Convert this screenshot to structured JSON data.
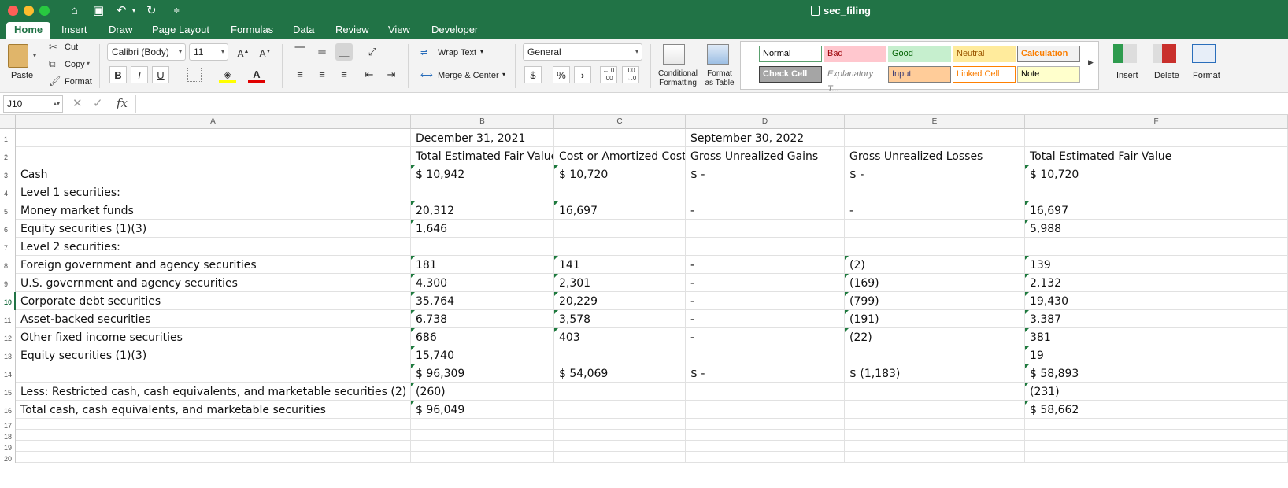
{
  "window": {
    "title": "sec_filing"
  },
  "tabs": [
    "Home",
    "Insert",
    "Draw",
    "Page Layout",
    "Formulas",
    "Data",
    "Review",
    "View",
    "Developer"
  ],
  "active_tab": "Home",
  "ribbon": {
    "paste_label": "Paste",
    "cut_label": "Cut",
    "copy_label": "Copy",
    "format_label": "Format",
    "font_name": "Calibri (Body)",
    "font_size": "11",
    "wrap_text_label": "Wrap Text",
    "merge_center_label": "Merge & Center",
    "number_format": "General",
    "conditional_formatting_label": "Conditional Formatting",
    "format_as_table_label": "Format as Table",
    "styles": [
      {
        "label": "Normal",
        "bg": "#ffffff",
        "fg": "#000000",
        "border": "#5aa06e"
      },
      {
        "label": "Bad",
        "bg": "#ffc7ce",
        "fg": "#9c0006",
        "border": "#ffc7ce"
      },
      {
        "label": "Good",
        "bg": "#c6efce",
        "fg": "#006100",
        "border": "#c6efce"
      },
      {
        "label": "Neutral",
        "bg": "#ffeb9c",
        "fg": "#9c5700",
        "border": "#ffeb9c"
      },
      {
        "label": "Calculation",
        "bg": "#f2f2f2",
        "fg": "#fa7d00",
        "border": "#7f7f7f"
      },
      {
        "label": "Check Cell",
        "bg": "#a5a5a5",
        "fg": "#ffffff",
        "border": "#3f3f3f"
      },
      {
        "label": "Explanatory T...",
        "bg": "#ffffff",
        "fg": "#7f7f7f",
        "border": "#ffffff"
      },
      {
        "label": "Input",
        "bg": "#ffcc99",
        "fg": "#3f3f76",
        "border": "#7f7f7f"
      },
      {
        "label": "Linked Cell",
        "bg": "#ffffff",
        "fg": "#fa7d00",
        "border": "#ff8001"
      },
      {
        "label": "Note",
        "bg": "#ffffcc",
        "fg": "#000000",
        "border": "#b2b2b2"
      }
    ],
    "insert_label": "Insert",
    "delete_label": "Delete",
    "format_cells_label": "Format"
  },
  "formula_bar": {
    "name_box": "J10",
    "fx": "fx",
    "content": ""
  },
  "sheet": {
    "columns": [
      "A",
      "B",
      "C",
      "D",
      "E",
      "F"
    ],
    "rows": [
      {
        "n": "1",
        "cells": [
          "",
          "December 31, 2021",
          "",
          "September 30, 2022",
          "",
          ""
        ]
      },
      {
        "n": "2",
        "cells": [
          "",
          "Total Estimated Fair Value",
          "Cost or Amortized Cost",
          "Gross Unrealized Gains",
          "Gross Unrealized Losses",
          "Total Estimated Fair Value"
        ]
      },
      {
        "n": "3",
        "cells": [
          "Cash",
          "$ 10,942",
          "$ 10,720",
          "$ -",
          "$ -",
          "$ 10,720"
        ]
      },
      {
        "n": "4",
        "cells": [
          "Level 1 securities:",
          "",
          "",
          "",
          "",
          ""
        ]
      },
      {
        "n": "5",
        "cells": [
          "Money market funds",
          "20,312",
          "16,697",
          "-",
          "-",
          "16,697"
        ]
      },
      {
        "n": "6",
        "cells": [
          "Equity securities (1)(3)",
          "1,646",
          "",
          "",
          "",
          "5,988"
        ]
      },
      {
        "n": "7",
        "cells": [
          "Level 2 securities:",
          "",
          "",
          "",
          "",
          ""
        ]
      },
      {
        "n": "8",
        "cells": [
          "Foreign government and agency securities",
          "181",
          "141",
          "-",
          "(2)",
          "139"
        ]
      },
      {
        "n": "9",
        "cells": [
          "U.S. government and agency securities",
          "4,300",
          "2,301",
          "-",
          "(169)",
          "2,132"
        ]
      },
      {
        "n": "10",
        "cells": [
          "Corporate debt securities",
          "35,764",
          "20,229",
          "-",
          "(799)",
          "19,430"
        ]
      },
      {
        "n": "11",
        "cells": [
          "Asset-backed securities",
          "6,738",
          "3,578",
          "-",
          "(191)",
          "3,387"
        ]
      },
      {
        "n": "12",
        "cells": [
          "Other fixed income securities",
          "686",
          "403",
          "-",
          "(22)",
          "381"
        ]
      },
      {
        "n": "13",
        "cells": [
          "Equity securities (1)(3)",
          "15,740",
          "",
          "",
          "",
          "19"
        ]
      },
      {
        "n": "14",
        "cells": [
          "",
          "$ 96,309",
          "$ 54,069",
          "$ -",
          "$ (1,183)",
          "$ 58,893"
        ]
      },
      {
        "n": "15",
        "cells": [
          "Less: Restricted cash, cash equivalents, and marketable securities (2)",
          "(260)",
          "",
          "",
          "",
          "(231)"
        ]
      },
      {
        "n": "16",
        "cells": [
          "Total cash, cash equivalents, and marketable securities",
          "$ 96,049",
          "",
          "",
          "",
          "$ 58,662"
        ]
      },
      {
        "n": "17",
        "cells": [
          "",
          "",
          "",
          "",
          "",
          ""
        ]
      },
      {
        "n": "18",
        "cells": [
          "",
          "",
          "",
          "",
          "",
          ""
        ]
      },
      {
        "n": "19",
        "cells": [
          "",
          "",
          "",
          "",
          "",
          ""
        ]
      },
      {
        "n": "20",
        "cells": [
          "",
          "",
          "",
          "",
          "",
          ""
        ]
      }
    ]
  }
}
